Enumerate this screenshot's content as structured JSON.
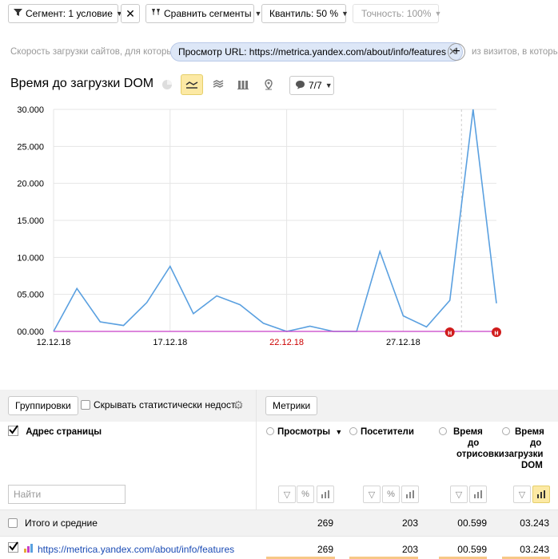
{
  "toolbar": {
    "segment_label": "Сегмент: 1 условие",
    "compare_label": "Сравнить сегменты",
    "quantile_label": "Квантиль: 50 %",
    "accuracy_label": "Точность: 100%"
  },
  "segment_row": {
    "prefix": "Скорость загрузки сайтов, для которых",
    "chip": "Просмотр URL: https://metrica.yandex.com/about/info/features",
    "suffix": "из визитов, в которых"
  },
  "chart_title": "Время до загрузки DOM",
  "series_count": "7/7",
  "chart_data": {
    "type": "line",
    "ylim": [
      0,
      30000
    ],
    "ylabels": [
      "30.000",
      "25.000",
      "20.000",
      "15.000",
      "10.000",
      "05.000",
      "00.000"
    ],
    "xlabels": [
      {
        "text": "12.12.18",
        "index": 0,
        "color": "#000000"
      },
      {
        "text": "17.12.18",
        "index": 5,
        "color": "#000000"
      },
      {
        "text": "22.12.18",
        "index": 10,
        "color": "#cc0000"
      },
      {
        "text": "27.12.18",
        "index": 15,
        "color": "#000000"
      }
    ],
    "x": [
      "12.12.18",
      "13.12.18",
      "14.12.18",
      "15.12.18",
      "16.12.18",
      "17.12.18",
      "18.12.18",
      "19.12.18",
      "20.12.18",
      "21.12.18",
      "22.12.18",
      "23.12.18",
      "24.12.18",
      "25.12.18",
      "26.12.18",
      "27.12.18",
      "28.12.18",
      "29.12.18",
      "30.12.18",
      "31.12.18"
    ],
    "series": [
      {
        "color": "#5aa0e0",
        "values": [
          0,
          5800,
          1300,
          800,
          3900,
          8800,
          2400,
          4800,
          3600,
          1100,
          0,
          700,
          0,
          0,
          10800,
          2100,
          600,
          4200,
          30000,
          3800
        ]
      },
      {
        "color": "#c63fc7",
        "values": [
          0,
          0,
          0,
          0,
          0,
          0,
          0,
          0,
          0,
          0,
          0,
          0,
          0,
          0,
          0,
          0,
          0,
          0,
          0,
          0
        ]
      }
    ],
    "markers": [
      {
        "index": 17,
        "text": "н"
      },
      {
        "index": 19,
        "text": "н"
      }
    ],
    "colors": {
      "grid": "#e5e5e5",
      "axis": "#000000"
    }
  },
  "panel": {
    "groupings_label": "Группировки",
    "hide_label": "Скрывать статистически недост...",
    "metrics_label": "Метрики"
  },
  "table": {
    "dim_header": "Адрес страницы",
    "search_placeholder": "Найти",
    "columns": [
      "Просмотры",
      "Посетители",
      "Время до отрисовки",
      "Время до загрузки DOM"
    ],
    "col_lines": {
      "c3": [
        "Время",
        "до",
        "отрисовки"
      ],
      "c4": [
        "Время",
        "до",
        "загрузки",
        "DOM"
      ]
    },
    "sort_arrow": "▼",
    "total": {
      "label": "Итого и средние",
      "values": [
        "269",
        "203",
        "00.599",
        "03.243"
      ]
    },
    "rows": [
      {
        "label": "https://metrica.yandex.com/about/info/features",
        "values": [
          "269",
          "203",
          "00.599",
          "03.243"
        ]
      }
    ]
  }
}
